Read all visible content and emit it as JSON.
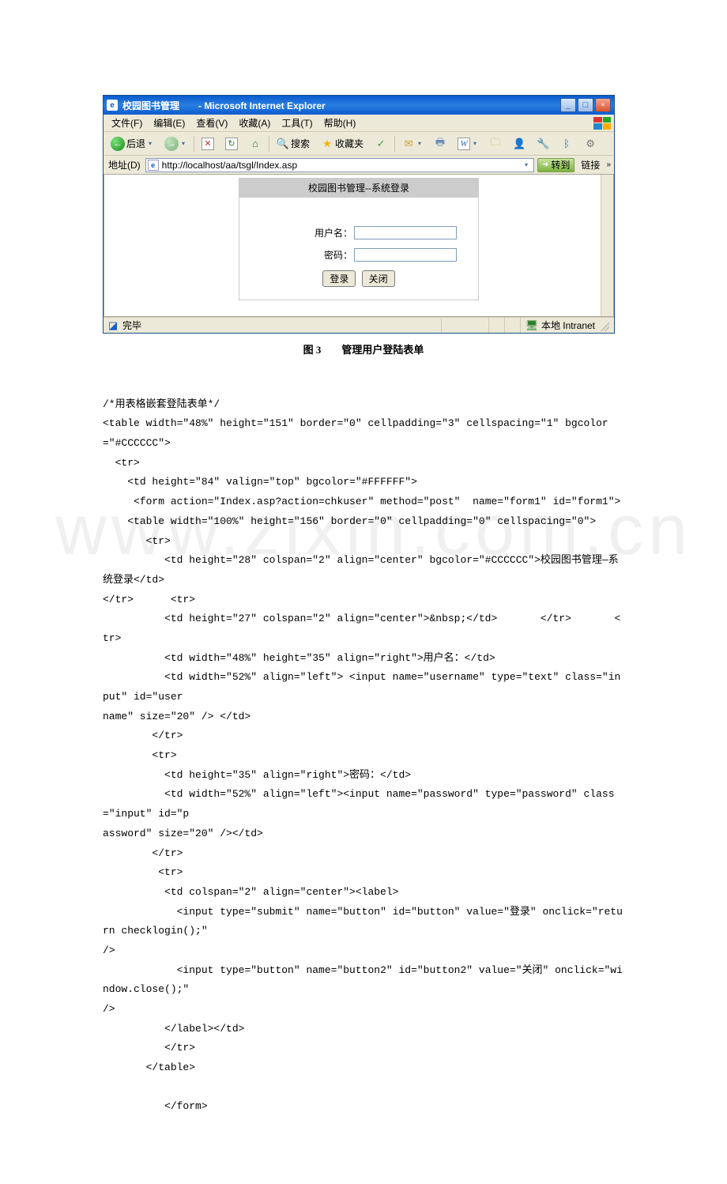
{
  "ie": {
    "title": "校园图书管理　　- Microsoft Internet Explorer",
    "menus": {
      "file": "文件(F)",
      "edit": "编辑(E)",
      "view": "查看(V)",
      "fav": "收藏(A)",
      "tools": "工具(T)",
      "help": "帮助(H)"
    },
    "toolbar": {
      "back": "后退",
      "search": "搜索",
      "favorites": "收藏夹"
    },
    "addrbar": {
      "label": "地址(D)",
      "url": "http://localhost/aa/tsgl/Index.asp",
      "go": "转到",
      "links": "链接"
    },
    "login": {
      "header": "校园图书管理--系统登录",
      "user_label": "用户名：",
      "pwd_label": "密码：",
      "login_btn": "登录",
      "close_btn": "关闭"
    },
    "status": {
      "done": "完毕",
      "zone": "本地 Intranet"
    }
  },
  "caption": "图 3　　管理用户登陆表单",
  "code": {
    "c0": "/*用表格嵌套登陆表单*/",
    "c1": "<table width=\"48%\" height=\"151\" border=\"0\" cellpadding=\"3\" cellspacing=\"1\" bgcolor=\"#CCCCCC\">",
    "c2": "  <tr>",
    "c3": "    <td height=\"84\" valign=\"top\" bgcolor=\"#FFFFFF\">",
    "c4": "     <form action=\"Index.asp?action=chkuser\" method=\"post\"  name=\"form1\" id=\"form1\">",
    "c5": "    <table width=\"100%\" height=\"156\" border=\"0\" cellpadding=\"0\" cellspacing=\"0\">",
    "c6": "       <tr>",
    "c7": "          <td height=\"28\" colspan=\"2\" align=\"center\" bgcolor=\"#CCCCCC\">校园图书管理—系统登录</td>",
    "c8": "</tr>      <tr>",
    "c9": "          <td height=\"27\" colspan=\"2\" align=\"center\">&nbsp;</td>       </tr>       <tr>",
    "c10": "          <td width=\"48%\" height=\"35\" align=\"right\">用户名：</td>",
    "c11": "          <td width=\"52%\" align=\"left\"> <input name=\"username\" type=\"text\" class=\"input\" id=\"user",
    "c12": "name\" size=\"20\" /> </td>",
    "c13": "        </tr>",
    "c14": "        <tr>",
    "c15": "          <td height=\"35\" align=\"right\">密码：</td>",
    "c16": "          <td width=\"52%\" align=\"left\"><input name=\"password\" type=\"password\" class=\"input\" id=\"p",
    "c17": "assword\" size=\"20\" /></td>",
    "c18": "        </tr>",
    "c19": "         <tr>",
    "c20": "          <td colspan=\"2\" align=\"center\"><label>",
    "c21": "            <input type=\"submit\" name=\"button\" id=\"button\" value=\"登录\" onclick=\"return checklogin();\"",
    "c22": "/>",
    "c23": "            <input type=\"button\" name=\"button2\" id=\"button2\" value=\"关闭\" onclick=\"window.close();\"",
    "c24": "/>",
    "c25": "          </label></td>",
    "c26": "          </tr>",
    "c27": "       </table>",
    "c28": "",
    "c29": "          </form>"
  },
  "watermark": "www.zixin.com.cn"
}
